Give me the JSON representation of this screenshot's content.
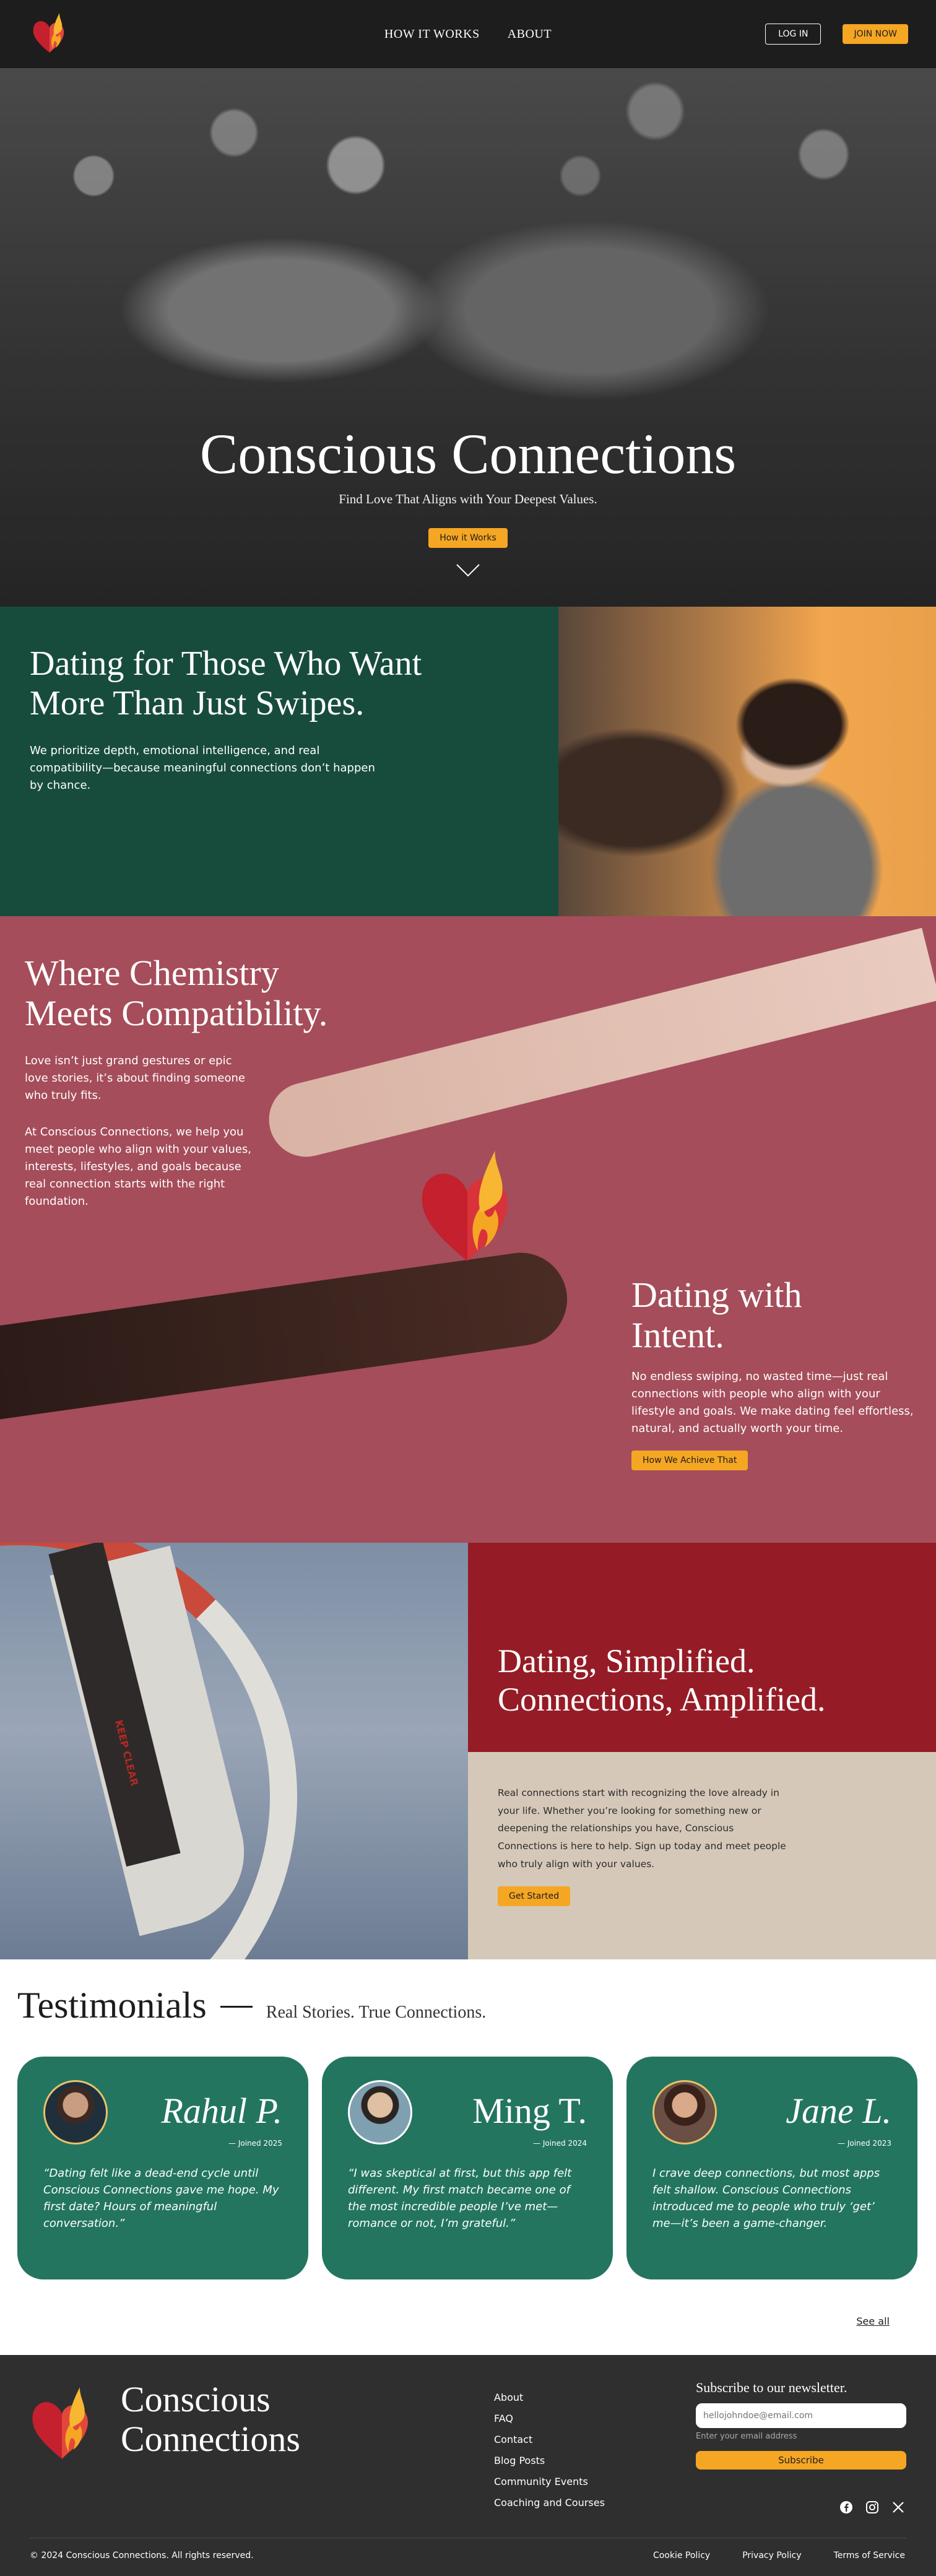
{
  "nav": {
    "links": [
      "HOW IT WORKS",
      "ABOUT"
    ],
    "login_label": "LOG IN",
    "join_label": "JOIN NOW"
  },
  "hero": {
    "title": "Conscious Connections",
    "subtitle": "Find Love That Aligns with Your Deepest Values.",
    "cta_label": "How it Works"
  },
  "intro": {
    "title_line1": "Dating for Those Who Want",
    "title_line2": "More Than Just Swipes.",
    "text": "We prioritize depth, emotional intelligence, and real compatibility—because meaningful connections don’t happen by chance."
  },
  "chemistry": {
    "title_line1": "Where Chemistry",
    "title_line2": "Meets Compatibility.",
    "p1": "Love isn’t just grand gestures or epic love stories, it’s about finding someone who truly fits.",
    "p2": "At Conscious Connections, we help you meet people who align with your values, interests, lifestyles, and goals because real connection starts with the right foundation.",
    "intent_title_line1": "Dating with",
    "intent_title_line2": "Intent.",
    "intent_text": "No endless swiping, no wasted time—just real connections with people who align with your lifestyle and goals. We make dating feel effortless, natural, and actually worth your time.",
    "intent_cta": "How We Achieve That"
  },
  "simplified": {
    "title_line1": "Dating, Simplified.",
    "title_line2": "Connections, Amplified.",
    "text": "Real connections start with recognizing the love already in your life. Whether you’re looking for something new or deepening the relationships you have, Conscious Connections is here to help. Sign up today and meet people who truly align with your values.",
    "cta": "Get Started",
    "ride_text": "KEEP CLEAR"
  },
  "testimonials": {
    "title": "Testimonials",
    "subtitle": "Real Stories. True Connections.",
    "cards": [
      {
        "name": "Rahul P.",
        "joined": "— Joined 2025",
        "quote": "“Dating felt like a dead-end cycle until Conscious Connections gave me hope. My first date? Hours of meaningful conversation.”"
      },
      {
        "name": "Ming T.",
        "joined": "— Joined 2024",
        "quote": "“I was skeptical at first, but this app felt different. My first match became one of the most incredible people I’ve met—romance or not, I’m grateful.”"
      },
      {
        "name": "Jane L.",
        "joined": "— Joined 2023",
        "quote": "I crave deep connections, but most apps felt shallow. Conscious Connections introduced me to people who truly ‘get’ me—it’s been a game-changer."
      }
    ],
    "see_all": "See all"
  },
  "footer": {
    "brand_line1": "Conscious",
    "brand_line2": "Connections",
    "links": [
      "About",
      "FAQ",
      "Contact",
      "Blog Posts",
      "Community Events",
      "Coaching and Courses"
    ],
    "newsletter_title": "Subscribe to our newsletter.",
    "email_placeholder": "hellojohndoe@email.com",
    "email_hint": "Enter your email address",
    "subscribe_label": "Subscribe",
    "social_icons": [
      "facebook-icon",
      "instagram-icon",
      "x-icon"
    ],
    "copyright": "© 2024 Conscious Connections. All rights reserved.",
    "legal": [
      "Cookie Policy",
      "Privacy Policy",
      "Terms of Service"
    ]
  },
  "colors": {
    "nav_bg": "#1d1d1d",
    "accent_yellow": "#f5a623",
    "green": "#174c3d",
    "rose": "#a54d5a",
    "crimson": "#951c26",
    "sand": "#d6c8b8",
    "card_green": "#237560"
  }
}
